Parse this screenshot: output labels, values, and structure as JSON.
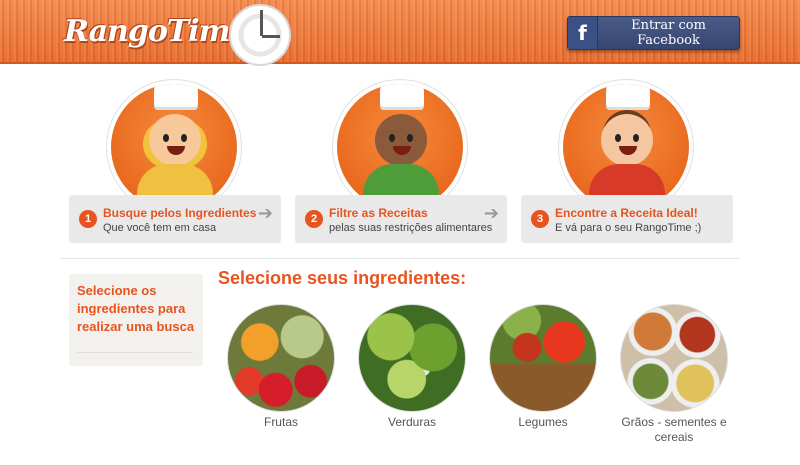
{
  "header": {
    "logo_text": "RangoTime",
    "facebook_icon": "f",
    "facebook_label": "Entrar com Facebook"
  },
  "steps": [
    {
      "number": "1",
      "title": "Busque pelos Ingredientes",
      "subtitle": "Que você tem em casa",
      "arrow": "➔"
    },
    {
      "number": "2",
      "title": "Filtre as Receitas",
      "subtitle": "pelas suas restrições alimentares",
      "arrow": "➔"
    },
    {
      "number": "3",
      "title": "Encontre a Receita Ideal!",
      "subtitle": "E vá para o seu RangoTime ;)"
    }
  ],
  "sidebar": {
    "text": "Selecione os ingredientes para realizar uma busca"
  },
  "main": {
    "title": "Selecione seus ingredientes:",
    "ingredients": [
      {
        "label": "Frutas"
      },
      {
        "label": "Verduras"
      },
      {
        "label": "Legumes"
      },
      {
        "label": "Grãos - sementes e cereais"
      }
    ]
  },
  "colors": {
    "accent": "#e8541f",
    "header": "#ee7a3a",
    "facebook": "#3b5186"
  }
}
